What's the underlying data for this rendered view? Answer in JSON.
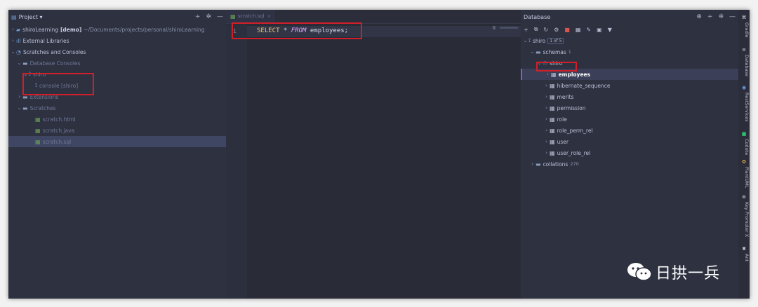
{
  "project": {
    "title": "Project ▾",
    "rows": [
      {
        "chev": "›",
        "indent": 0,
        "icon": "module-icon",
        "label": "shiroLearning",
        "bold": "[demo]",
        "path": "~/Documents/projects/personal/shiroLearning",
        "dim": false
      },
      {
        "chev": "›",
        "indent": 0,
        "icon": "library-icon",
        "label": "External Libraries",
        "dim": false
      },
      {
        "chev": "⌄",
        "indent": 0,
        "icon": "scratches-icon",
        "label": "Scratches and Consoles",
        "dim": false
      },
      {
        "chev": "⌄",
        "indent": 1,
        "icon": "folder-icon",
        "label": "Database Consoles",
        "dim": true
      },
      {
        "chev": "⌄",
        "indent": 2,
        "icon": "datasource-icon",
        "label": "shiro",
        "dim": true
      },
      {
        "chev": "",
        "indent": 3,
        "icon": "console-icon",
        "label": "console [shiro]",
        "dim": true
      },
      {
        "chev": "›",
        "indent": 1,
        "icon": "folder-icon",
        "label": "Extensions",
        "dim": true
      },
      {
        "chev": "⌄",
        "indent": 1,
        "icon": "folder-icon",
        "label": "Scratches",
        "dim": true
      },
      {
        "chev": "",
        "indent": 3,
        "icon": "scratch-file-icon",
        "label": "scratch.html",
        "dim": true
      },
      {
        "chev": "",
        "indent": 3,
        "icon": "scratch-file-icon",
        "label": "scratch.java",
        "dim": true
      },
      {
        "chev": "",
        "indent": 3,
        "icon": "scratch-file-icon",
        "label": "scratch.sql",
        "dim": true,
        "selected": true
      }
    ]
  },
  "editor": {
    "tab_label": "scratch.sql",
    "tab_close": "×",
    "line_number": "1",
    "code": {
      "kw1": "SELECT",
      "mid": " * ",
      "kw2": "FROM",
      "rest": " employees;"
    },
    "pause_indicator": "II"
  },
  "database": {
    "title": "Database",
    "rows": [
      {
        "chev": "⌄",
        "indent": 0,
        "type": "datasource",
        "label": "shiro",
        "badge_box": "1 of 5"
      },
      {
        "chev": "⌄",
        "indent": 1,
        "type": "folder",
        "label": "schemas",
        "badge": "1"
      },
      {
        "chev": "⌄",
        "indent": 2,
        "type": "schema",
        "label": "shiro"
      },
      {
        "chev": "›",
        "indent": 3,
        "type": "table",
        "label": "employees",
        "selected": true
      },
      {
        "chev": "›",
        "indent": 3,
        "type": "table",
        "label": "hibernate_sequence"
      },
      {
        "chev": "›",
        "indent": 3,
        "type": "table",
        "label": "merits"
      },
      {
        "chev": "›",
        "indent": 3,
        "type": "table",
        "label": "permission"
      },
      {
        "chev": "›",
        "indent": 3,
        "type": "table",
        "label": "role"
      },
      {
        "chev": "›",
        "indent": 3,
        "type": "table",
        "label": "role_perm_rel"
      },
      {
        "chev": "›",
        "indent": 3,
        "type": "table",
        "label": "user"
      },
      {
        "chev": "›",
        "indent": 3,
        "type": "table",
        "label": "user_role_rel"
      },
      {
        "chev": "›",
        "indent": 1,
        "type": "folder",
        "label": "collations",
        "badge": "270"
      }
    ]
  },
  "right_strip": {
    "items": [
      {
        "label": "Gradle",
        "icon": "gradle-icon"
      },
      {
        "label": "Database",
        "icon": "database-icon"
      },
      {
        "label": "RestServices",
        "icon": "rest-services-icon"
      },
      {
        "label": "Codota",
        "icon": "codota-icon"
      },
      {
        "label": "PlantUML",
        "icon": "plantuml-icon"
      },
      {
        "label": "Key Promoter X",
        "icon": "key-promoter-icon"
      },
      {
        "label": "Ant",
        "icon": "ant-icon"
      }
    ]
  },
  "watermark": {
    "text": "日拱一兵"
  },
  "colors": {
    "highlight": "#d11f2a",
    "accent_selection": "#8a5ad3"
  }
}
